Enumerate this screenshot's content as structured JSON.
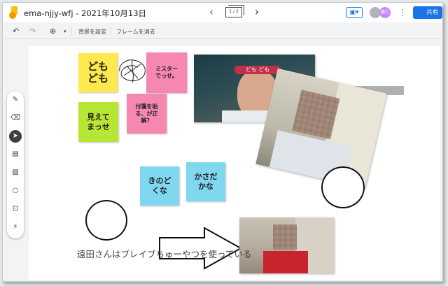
{
  "titlebar": {
    "app_icon": "jamboard-logo-icon",
    "title": "ema-njjy-wfj - 2021年10月13日",
    "frame_counter": "1 / 2",
    "share_label": "共有",
    "avatar_label": "義仁"
  },
  "toolbar": {
    "set_background_label": "背景を設定",
    "clear_frame_label": "フレームを消去"
  },
  "tools": [
    "pen-icon",
    "eraser-icon",
    "select-icon",
    "sticky-note-icon",
    "image-icon",
    "circle-icon",
    "text-box-icon",
    "laser-icon"
  ],
  "canvas": {
    "notes": {
      "yellow": "ども\nども",
      "pink1": "ミスター\nでっせ。",
      "green": "見えて\nまっせ",
      "pink2": "付箋を貼\nる、が正\n解？",
      "blue1": "きのど\nくな",
      "blue2": "かさだ\nかな"
    },
    "caption": "遠田さんはブレイブちゅーやつを使っている"
  },
  "colors": {
    "accent": "#1a73e8",
    "note_yellow": "#ffe94e",
    "note_pink": "#f587b0",
    "note_green": "#b8e635",
    "note_blue": "#7fd8f0"
  }
}
